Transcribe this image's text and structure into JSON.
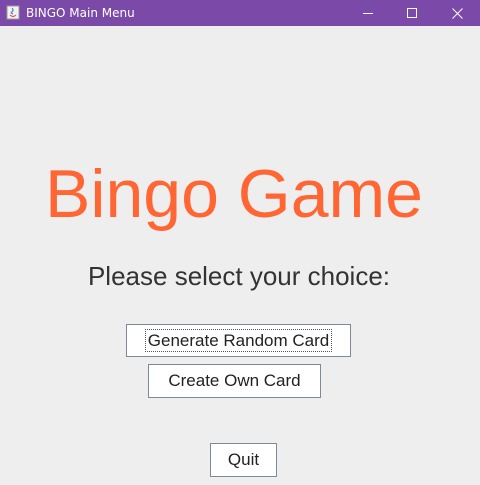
{
  "window": {
    "title": "BINGO Main Menu",
    "titlebar_color": "#7b49a7",
    "background_color": "#eeeeee"
  },
  "main": {
    "heading": "Bingo Game",
    "heading_color": "#ff6633",
    "prompt": "Please select your choice:",
    "buttons": {
      "generate_random": "Generate Random Card",
      "create_own": "Create Own Card",
      "quit": "Quit"
    }
  },
  "icons": {
    "app": "java-app-icon",
    "minimize": "minimize-icon",
    "maximize": "maximize-icon",
    "close": "close-icon"
  }
}
